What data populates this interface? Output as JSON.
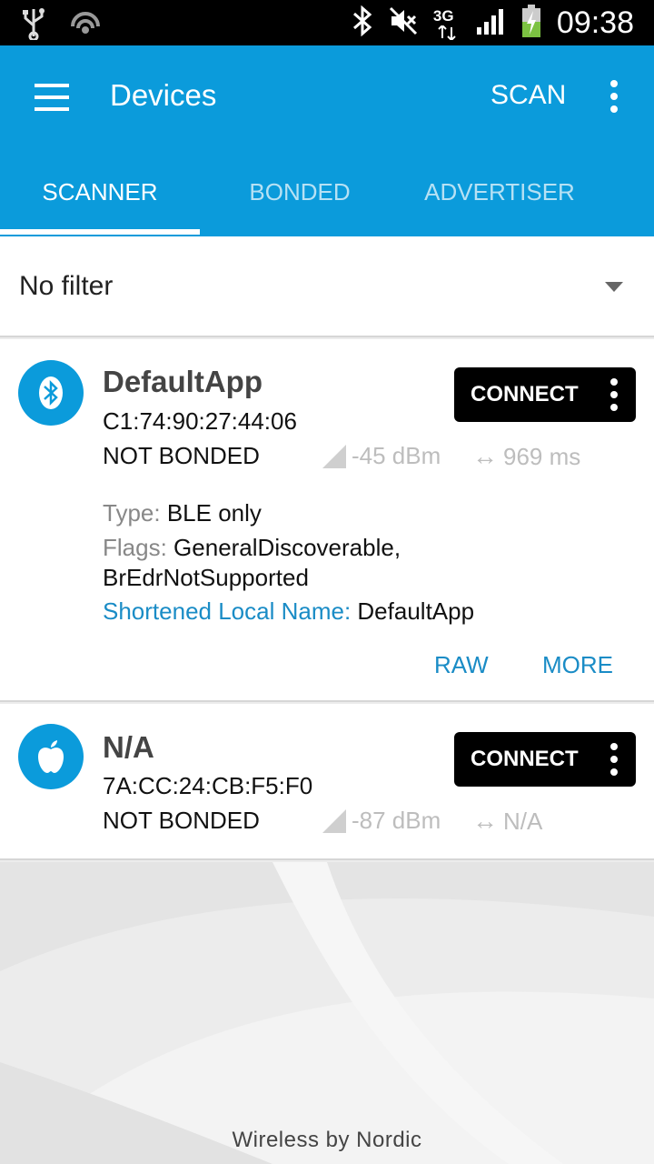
{
  "status_bar": {
    "time": "09:38",
    "icons": [
      "usb-icon",
      "cast-icon",
      "bluetooth-icon",
      "mute-icon",
      "network-3g-icon",
      "signal-icon",
      "battery-charging-icon"
    ],
    "network_label": "3G"
  },
  "appbar": {
    "title": "Devices",
    "scan_label": "SCAN",
    "color": "#0b9bdb"
  },
  "tabs": [
    {
      "label": "SCANNER",
      "active": true
    },
    {
      "label": "BONDED",
      "active": false
    },
    {
      "label": "ADVERTISER",
      "active": false
    }
  ],
  "filter": {
    "selected": "No filter"
  },
  "devices": [
    {
      "name": "DefaultApp",
      "address": "C1:74:90:27:44:06",
      "bond_state": "NOT BONDED",
      "rssi": "-45 dBm",
      "interval": "969 ms",
      "icon": "bluetooth-icon",
      "connect_label": "CONNECT",
      "details": {
        "type_label": "Type:",
        "type_value": "BLE only",
        "flags_label": "Flags:",
        "flags_value_1": "GeneralDiscoverable,",
        "flags_value_2": "BrEdrNotSupported",
        "name_label": "Shortened Local Name:",
        "name_value": "DefaultApp"
      },
      "actions": {
        "raw": "RAW",
        "more": "MORE"
      }
    },
    {
      "name": "N/A",
      "address": "7A:CC:24:CB:F5:F0",
      "bond_state": "NOT BONDED",
      "rssi": "-87 dBm",
      "interval": "N/A",
      "icon": "apple-icon",
      "connect_label": "CONNECT"
    }
  ],
  "footer": "Wireless by Nordic"
}
